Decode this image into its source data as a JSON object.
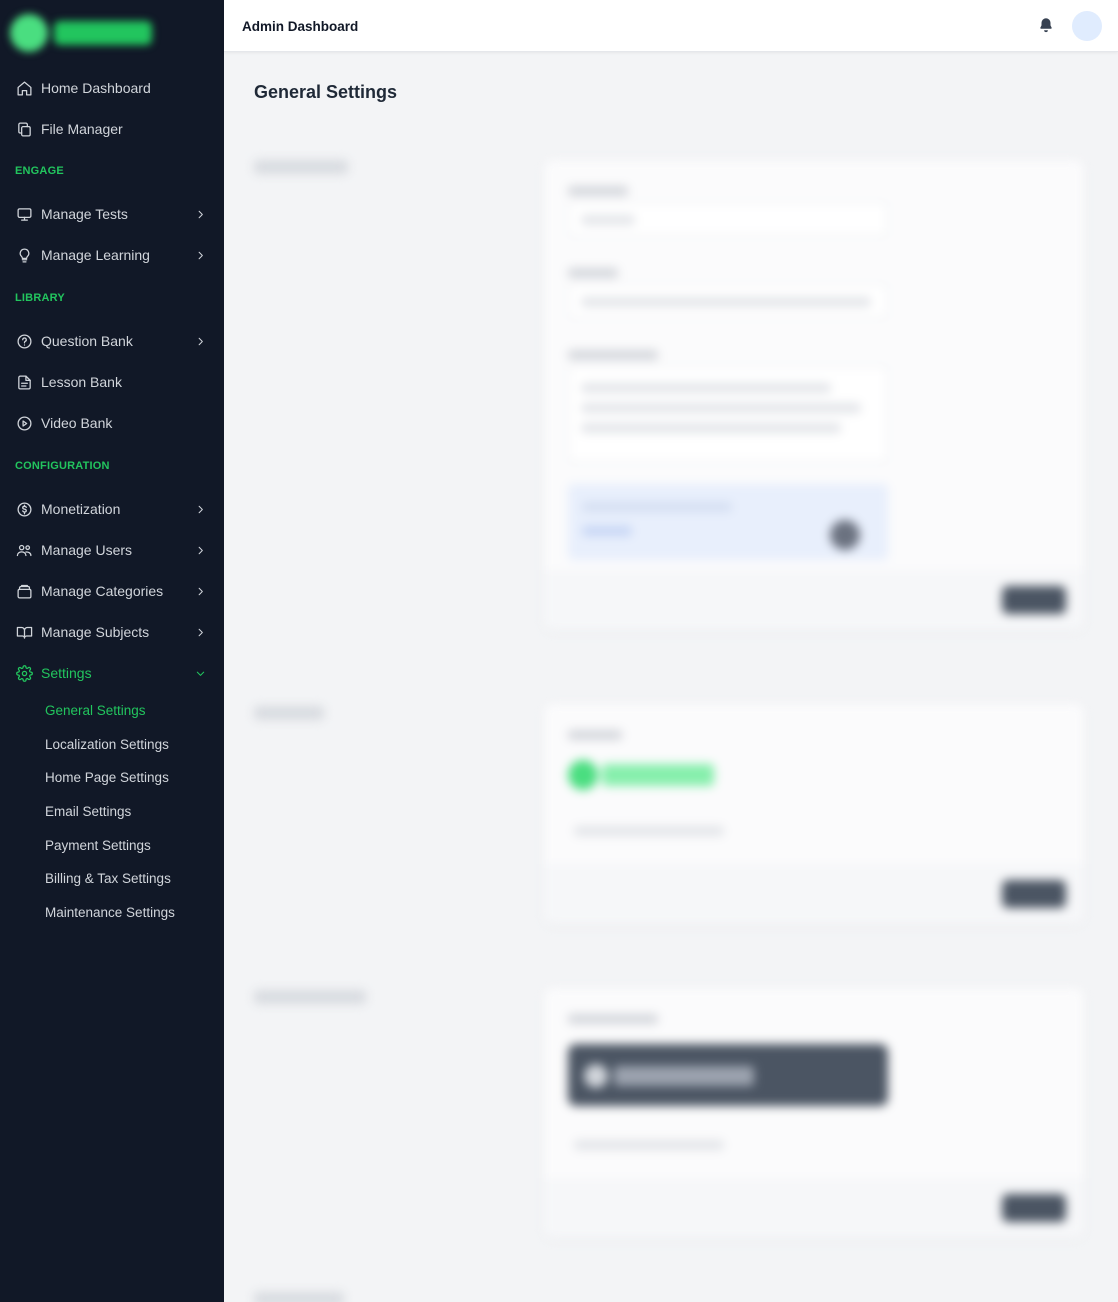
{
  "header": {
    "title": "Admin Dashboard"
  },
  "page": {
    "title": "General Settings"
  },
  "sidebar": {
    "top_items": [
      {
        "label": "Home Dashboard",
        "icon": "home-icon"
      },
      {
        "label": "File Manager",
        "icon": "copy-icon"
      }
    ],
    "sections": {
      "engage": "ENGAGE",
      "library": "LIBRARY",
      "configuration": "CONFIGURATION"
    },
    "engage_items": [
      {
        "label": "Manage Tests",
        "icon": "monitor-icon"
      },
      {
        "label": "Manage Learning",
        "icon": "lightbulb-icon"
      }
    ],
    "library_items": [
      {
        "label": "Question Bank",
        "icon": "help-circle-icon"
      },
      {
        "label": "Lesson Bank",
        "icon": "file-text-icon"
      },
      {
        "label": "Video Bank",
        "icon": "play-circle-icon"
      }
    ],
    "config_items": [
      {
        "label": "Monetization",
        "icon": "dollar-circle-icon"
      },
      {
        "label": "Manage Users",
        "icon": "users-icon"
      },
      {
        "label": "Manage Categories",
        "icon": "layers-icon"
      },
      {
        "label": "Manage Subjects",
        "icon": "book-open-icon"
      },
      {
        "label": "Settings",
        "icon": "gear-icon"
      }
    ],
    "settings_sub": [
      "General Settings",
      "Localization Settings",
      "Home Page Settings",
      "Email Settings",
      "Payment Settings",
      "Billing & Tax Settings",
      "Maintenance Settings"
    ]
  },
  "colors": {
    "sidebar_bg": "#111827",
    "accent": "#22c55e",
    "page_bg": "#f3f4f6"
  }
}
